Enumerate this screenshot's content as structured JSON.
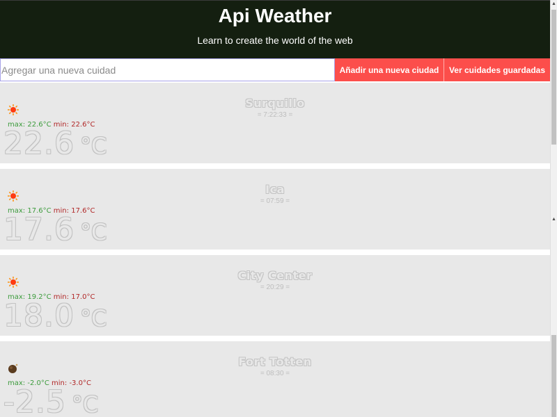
{
  "header": {
    "title": "Api Weather",
    "subtitle": "Learn to create the world of the web"
  },
  "controls": {
    "placeholder": "Agregar una nueva cuidad",
    "add_label": "Añadir una nueva ciudad",
    "saved_label": "Ver cuidades guardadas"
  },
  "labels": {
    "max": "max:",
    "min": "min:",
    "unit": "°C"
  },
  "cities": [
    {
      "name": "Surquillo",
      "time": "= 7:22:33 =",
      "icon": "sun-icon",
      "max": "22.6°C",
      "min": "22.6°C",
      "temp": "22.6"
    },
    {
      "name": "Ica",
      "time": "= 07:59 =",
      "icon": "sun-icon",
      "max": "17.6°C",
      "min": "17.6°C",
      "temp": "17.6"
    },
    {
      "name": "City Center",
      "time": "= 20:29 =",
      "icon": "sun-icon",
      "max": "19.2°C",
      "min": "17.0°C",
      "temp": "18.0"
    },
    {
      "name": "Fort Totten",
      "time": "= 08:30 =",
      "icon": "moon-icon",
      "max": "-2.0°C",
      "min": "-3.0°C",
      "temp": "-2.5"
    }
  ],
  "colors": {
    "header_bg": "#141f10",
    "button_bg": "#fc4e4b",
    "card_bg": "#e8e8e8",
    "max_color": "#3c9b3c",
    "min_color": "#b12828"
  }
}
